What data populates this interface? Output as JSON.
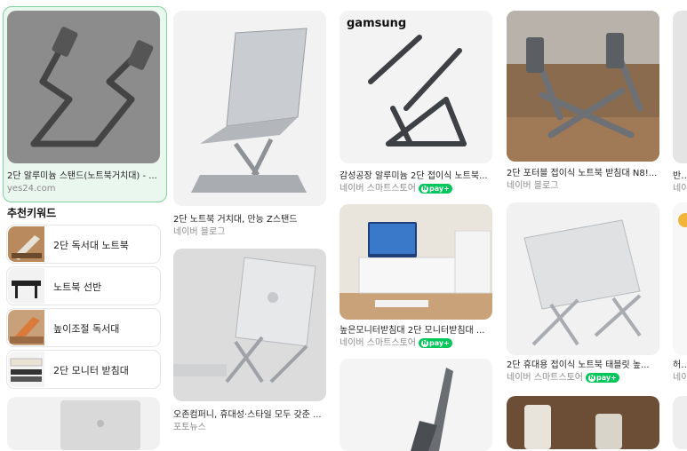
{
  "results": [
    {
      "title": "2단 알루미늄 스탠드(노트북거치대) - ...",
      "source": "yes24.com",
      "npay": false
    },
    {
      "title": "2단 노트북 거치대, 만능 Z스탠드",
      "source": "네이버 블로그",
      "npay": false
    },
    {
      "title": "감성공장 알루미늄 2단 접이식 노트북...",
      "source": "네이버 스마트스토어",
      "npay": true
    },
    {
      "title": "2단 포터블 접이식 노트북 받침대 N8!...",
      "source": "네이버 블로그",
      "npay": false
    },
    {
      "title": "반라",
      "source": "네이",
      "npay": false
    },
    {
      "title": "오존컴퍼니, 휴대성·스타일 모두 갖춘 ...",
      "source": "포토뉴스",
      "npay": false
    },
    {
      "title": "높은모니터받침대 2단 모니터받침대 ...",
      "source": "네이버 스마트스토어",
      "npay": true
    },
    {
      "title": "2단 휴대용 접이식 노트북 태블릿 높...",
      "source": "네이버 스마트스토어",
      "npay": true
    },
    {
      "title": "허리",
      "source": "네이",
      "npay": false
    }
  ],
  "brand_watermark": "gamsung",
  "npay_label": "pay+",
  "related": {
    "title": "추천키워드",
    "items": [
      {
        "label": "2단 독서대 노트북"
      },
      {
        "label": "노트북 선반"
      },
      {
        "label": "높이조절 독서대"
      },
      {
        "label": "2단 모니터 받침대"
      }
    ]
  },
  "colors": {
    "selected_border": "#7fd39a",
    "selected_bg": "#eaf7ee",
    "npay_green": "#03c75a"
  }
}
